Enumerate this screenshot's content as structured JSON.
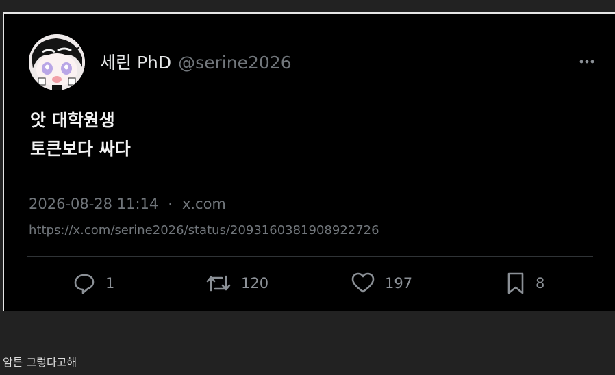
{
  "tweet": {
    "author": {
      "display_name": "세린 PhD",
      "handle": "@serine2026",
      "avatar_icon": "anime-avatar"
    },
    "text_lines": [
      "앗 대학원생",
      "토큰보다 싸다"
    ],
    "timestamp": "2026-08-28 11:14",
    "separator": "·",
    "source": "x.com",
    "url": "https://x.com/serine2026/status/2093160381908922726",
    "actions": {
      "reply": {
        "icon": "reply-icon",
        "count": "1"
      },
      "retweet": {
        "icon": "retweet-icon",
        "count": "120"
      },
      "like": {
        "icon": "heart-icon",
        "count": "197"
      },
      "bookmark": {
        "icon": "bookmark-icon",
        "count": "8"
      }
    },
    "more_icon": "more-dots-icon"
  },
  "comment": {
    "text": "암튼 그렇다고해"
  },
  "colors": {
    "page_bg": "#222222",
    "card_bg": "#000000",
    "text_primary": "#e7e9ea",
    "text_secondary": "#71767b"
  }
}
